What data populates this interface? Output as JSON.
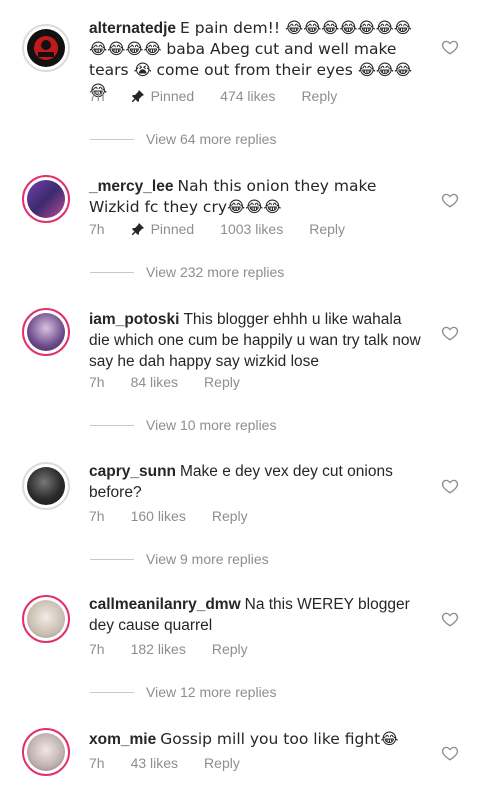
{
  "comments": [
    {
      "username": "alternatedje",
      "text": "E pain dem!! 😂😂😂😂😂😂😂😂😂😂😂 baba Abeg cut and well make tears 😭 come out from their eyes 😂😂😂😂",
      "time": "7h",
      "pinned": "Pinned",
      "likes": "474 likes",
      "reply": "Reply",
      "view_more": "View 64 more replies",
      "avatar_color": "#c21a1a"
    },
    {
      "username": "_mercy_lee",
      "text": "Nah this onion they make Wizkid fc they cry😂😂😂",
      "time": "7h",
      "pinned": "Pinned",
      "likes": "1003 likes",
      "reply": "Reply",
      "view_more": "View 232 more replies",
      "avatar_color": "#6b3fa0"
    },
    {
      "username": "iam_potoski",
      "text": "This blogger ehhh u like wahala die which one cum be happily u wan try talk now say he dah happy say wizkid lose",
      "time": "7h",
      "likes": "84 likes",
      "reply": "Reply",
      "view_more": "View 10 more replies",
      "avatar_color": "#5a3d7a"
    },
    {
      "username": "capry_sunn",
      "text": "Make e dey vex  dey cut onions before?",
      "time": "7h",
      "likes": "160 likes",
      "reply": "Reply",
      "view_more": "View 9 more replies",
      "avatar_color": "#2e2e2e"
    },
    {
      "username": "callmeanilanry_dmw",
      "text": "Na this WEREY blogger dey cause quarrel",
      "time": "7h",
      "likes": "182 likes",
      "reply": "Reply",
      "view_more": "View 12 more replies",
      "avatar_color": "#d8d2c8"
    },
    {
      "username": "xom_mie",
      "text": "Gossip mill you too like fight😂",
      "time": "7h",
      "likes": "43 likes",
      "reply": "Reply",
      "avatar_color": "#cfc3c0"
    }
  ],
  "colors": {
    "story_ring": "#e1306c",
    "meta_text": "#8e8e8e",
    "text": "#262626"
  },
  "icons": {
    "like": "heart-outline-icon",
    "pin": "pin-icon"
  }
}
